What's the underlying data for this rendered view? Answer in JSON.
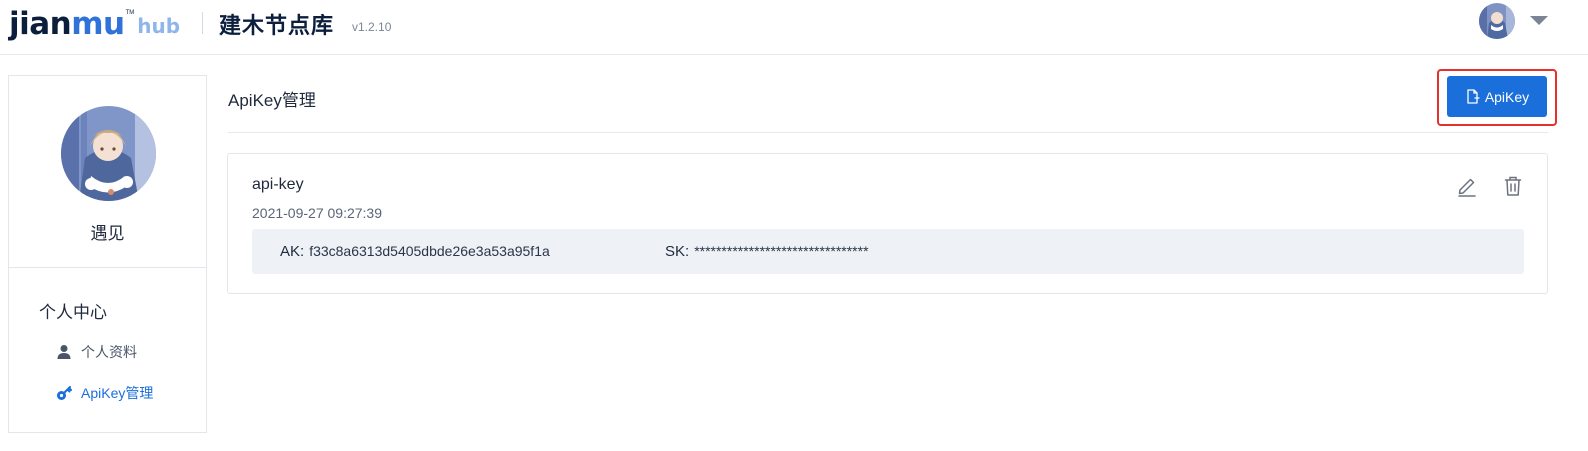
{
  "header": {
    "logo": {
      "main": "jian",
      "accent": "mu",
      "tm": "TM",
      "hub": "hub"
    },
    "title": "建木节点库",
    "version": "v1.2.10",
    "user_menu_icon": "chevron-down-icon"
  },
  "sidebar": {
    "profile_name": "遇见",
    "section_title": "个人中心",
    "items": [
      {
        "label": "个人资料",
        "icon": "user-icon",
        "active": false
      },
      {
        "label": "ApiKey管理",
        "icon": "key-icon",
        "active": true
      }
    ]
  },
  "main": {
    "page_title": "ApiKey管理",
    "add_button_label": "ApiKey",
    "add_button_icon": "new-document-icon",
    "keys": [
      {
        "name": "api-key",
        "created": "2021-09-27 09:27:39",
        "ak_label": "AK:",
        "ak_value": "f33c8a6313d5405dbde26e3a53a95f1a",
        "sk_label": "SK:",
        "sk_value": "********************************"
      }
    ]
  },
  "colors": {
    "accent": "#1a6fdb",
    "highlight_frame": "#e5312b",
    "key_box_bg": "#eef2f7"
  }
}
